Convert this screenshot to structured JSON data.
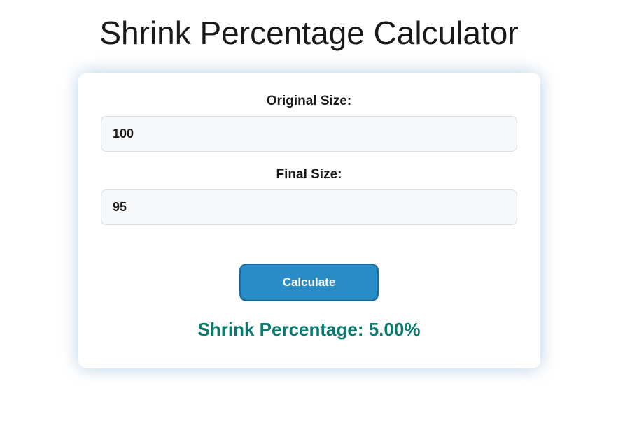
{
  "title": "Shrink Percentage Calculator",
  "form": {
    "original_label": "Original Size:",
    "original_value": "100",
    "final_label": "Final Size:",
    "final_value": "95"
  },
  "button": {
    "calculate": "Calculate"
  },
  "result": {
    "text": "Shrink Percentage: 5.00%"
  }
}
